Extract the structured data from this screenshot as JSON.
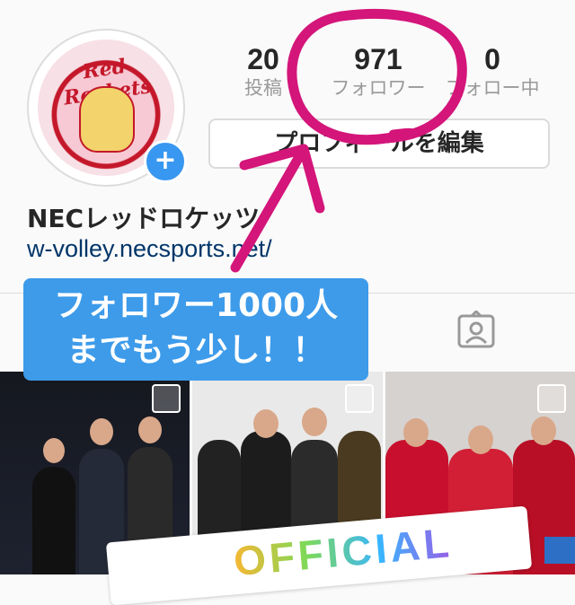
{
  "profile": {
    "username": "NECレッドロケッツ",
    "url": "w-volley.necsports.net/",
    "avatar_logo_text": "Red Rockets",
    "stats": [
      {
        "value": "20",
        "label": "投稿"
      },
      {
        "value": "971",
        "label": "フォロワー"
      },
      {
        "value": "0",
        "label": "フォロー中"
      }
    ],
    "edit_button": "プロフィールを編集"
  },
  "overlay": {
    "callout_line1": "フォロワー1000人",
    "callout_line2": "までもう少し！！",
    "sticker_text": "OFFICIAL"
  },
  "colors": {
    "annotation": "#d4157a",
    "callout_bg": "#3d9bea",
    "link": "#003569",
    "badge": "#3897f0"
  }
}
